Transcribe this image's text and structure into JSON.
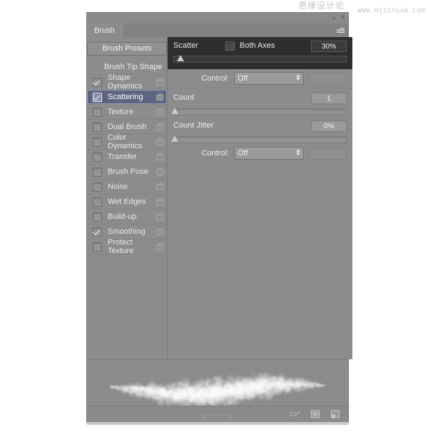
{
  "watermark": {
    "cn": "思缘设计论坛",
    "en": "WWW.MISSYUAN.COM"
  },
  "panel": {
    "tab_label": "Brush",
    "menu_icon": "panel-menu-icon",
    "collapse_icon": "collapse-double-arrow-icon",
    "close_icon": "close-icon"
  },
  "left": {
    "presets_button": "Brush Presets",
    "tip_shape": "Brush Tip Shape",
    "options": [
      {
        "label": "Shape Dynamics",
        "checked": true,
        "selected": false,
        "lock": "lock-icon"
      },
      {
        "label": "Scattering",
        "checked": true,
        "selected": true,
        "lock": "lock-icon"
      },
      {
        "label": "Texture",
        "checked": false,
        "selected": false,
        "lock": "lock-icon"
      },
      {
        "label": "Dual Brush",
        "checked": false,
        "selected": false,
        "lock": "lock-icon"
      },
      {
        "label": "Color Dynamics",
        "checked": false,
        "selected": false,
        "lock": "lock-icon"
      },
      {
        "label": "Transfer",
        "checked": false,
        "selected": false,
        "lock": "lock-icon"
      },
      {
        "label": "Brush Pose",
        "checked": false,
        "selected": false,
        "lock": "lock-icon"
      },
      {
        "label": "Noise",
        "checked": false,
        "selected": false,
        "lock": "lock-icon"
      },
      {
        "label": "Wet Edges",
        "checked": false,
        "selected": false,
        "lock": "lock-icon"
      },
      {
        "label": "Build-up",
        "checked": false,
        "selected": false,
        "lock": "lock-icon"
      },
      {
        "label": "Smoothing",
        "checked": true,
        "selected": false,
        "lock": "lock-icon"
      },
      {
        "label": "Protect Texture",
        "checked": false,
        "selected": false,
        "lock": "lock-icon"
      }
    ]
  },
  "right": {
    "scatter": {
      "label": "Scatter",
      "both_axes_label": "Both Axes",
      "both_axes_checked": false,
      "value": "30%",
      "slider_percent": 4
    },
    "scatter_control": {
      "label": "Control:",
      "value": "Off"
    },
    "count": {
      "label": "Count",
      "value": "1",
      "slider_percent": 1
    },
    "count_jitter": {
      "label": "Count Jitter",
      "value": "0%",
      "slider_percent": 1
    },
    "count_jitter_control": {
      "label": "Control:",
      "value": "Off"
    }
  },
  "footer": {
    "icons": [
      {
        "name": "create-new-brush-preset-icon"
      },
      {
        "name": "new-document-icon"
      },
      {
        "name": "delete-brush-icon"
      }
    ],
    "resize_grip": "resize-grip"
  },
  "colors": {
    "panel_bg": "#8c8c8c",
    "highlight_blue": "#5e6580",
    "dark_block": "#2e2e2e",
    "text": "#ededed"
  }
}
